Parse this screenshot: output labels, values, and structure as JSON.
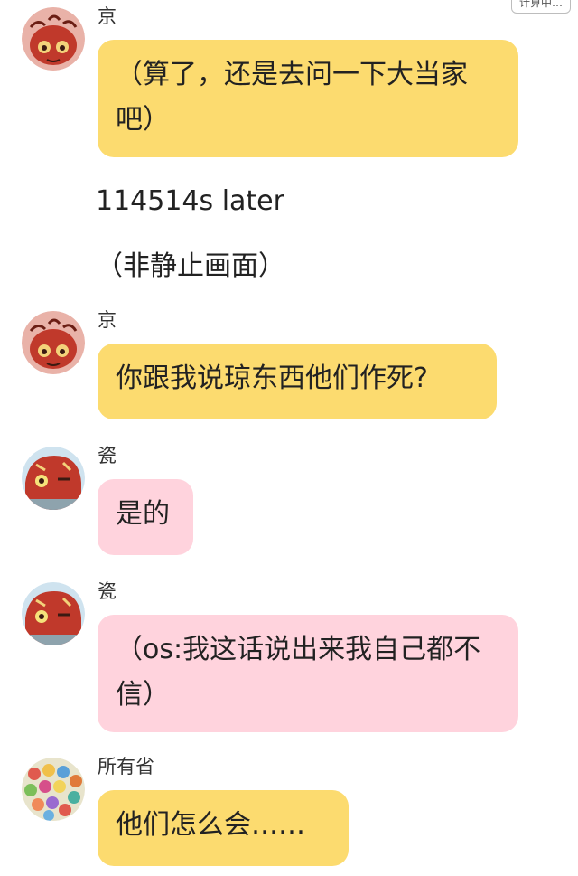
{
  "corner_chip": "计算中…",
  "messages": [
    {
      "sender": "京",
      "text": "（算了，还是去问一下大当家吧）"
    },
    {
      "sender": "京",
      "text": "你跟我说琼东西他们作死?"
    },
    {
      "sender": "瓷",
      "text": "是的"
    },
    {
      "sender": "瓷",
      "text": "（os:我这话说出来我自己都不信）"
    },
    {
      "sender": "所有省",
      "text": "他们怎么会……"
    }
  ],
  "narration": [
    "114514s later",
    "（非静止画面）"
  ],
  "colors": {
    "bubble_yellow": "#fcdb6f",
    "bubble_pink": "#ffd3dd",
    "avatar_jing_bg": "#e9b2a8",
    "avatar_ci_bg": "#cfe3ef",
    "avatar_all_bg": "#e8e4cc"
  },
  "avatars": [
    "jing-avatar",
    "ci-avatar",
    "ci-avatar",
    "all-provinces-avatar"
  ]
}
